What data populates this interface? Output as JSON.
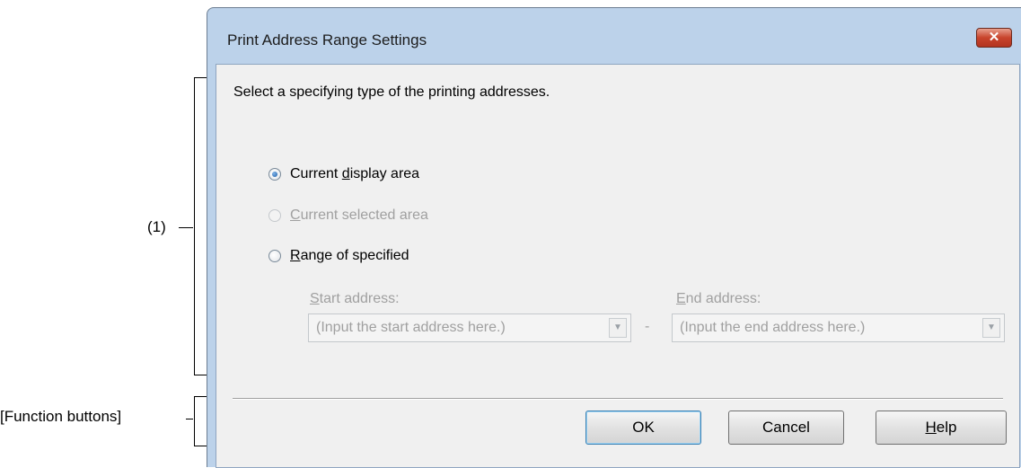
{
  "annotations": {
    "section1_label": "(1)",
    "function_buttons_label": "[Function buttons]"
  },
  "dialog": {
    "title": "Print Address Range Settings",
    "close_glyph": "✕",
    "description": "Select a specifying type of the printing addresses.",
    "options": [
      {
        "pre": "Current ",
        "mnemonic": "d",
        "post": "isplay area",
        "checked": true,
        "enabled": true
      },
      {
        "pre": "",
        "mnemonic": "C",
        "post": "urrent selected area",
        "checked": false,
        "enabled": false
      },
      {
        "pre": "",
        "mnemonic": "R",
        "post": "ange of specified",
        "checked": false,
        "enabled": true
      }
    ],
    "start_address": {
      "label_mnemonic": "S",
      "label_rest": "tart address:",
      "placeholder": "(Input the start address here.)"
    },
    "range_separator": "-",
    "end_address": {
      "label_mnemonic": "E",
      "label_rest": "nd address:",
      "placeholder": "(Input the end address here.)"
    },
    "buttons": {
      "ok": "OK",
      "cancel": "Cancel",
      "help_mnemonic": "H",
      "help_rest": "elp"
    }
  }
}
